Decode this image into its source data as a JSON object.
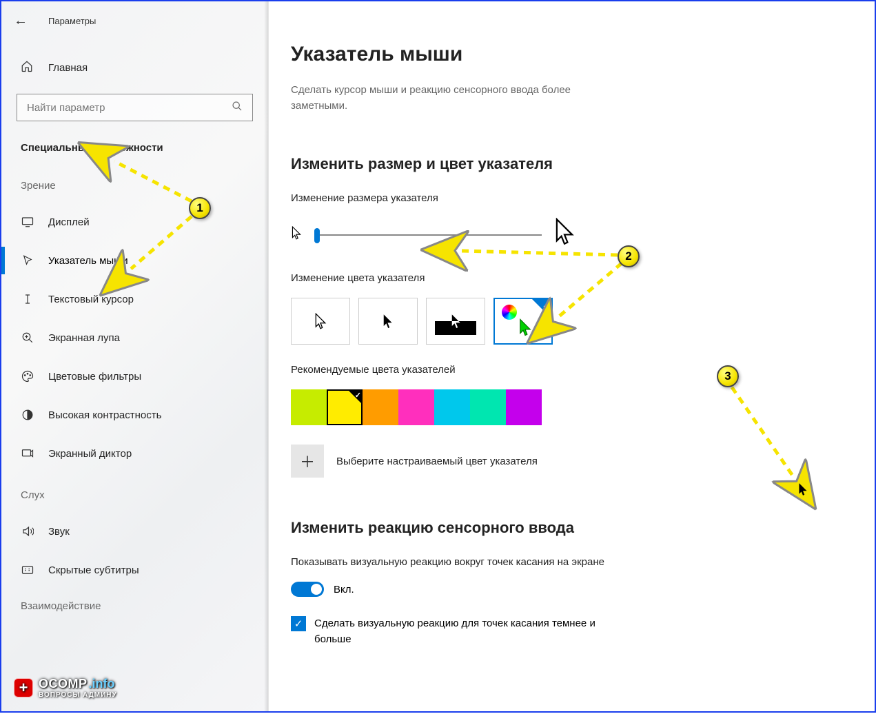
{
  "header": {
    "app_title": "Параметры"
  },
  "sidebar": {
    "home": "Главная",
    "search_placeholder": "Найти параметр",
    "group": "Специальные возможности",
    "cat_vision": "Зрение",
    "cat_hearing": "Слух",
    "cat_interaction": "Взаимодействие",
    "items_vision": [
      "Дисплей",
      "Указатель мыши",
      "Текстовый курсор",
      "Экранная лупа",
      "Цветовые фильтры",
      "Высокая контрастность",
      "Экранный диктор"
    ],
    "items_hearing": [
      "Звук",
      "Скрытые субтитры"
    ]
  },
  "main": {
    "title": "Указатель мыши",
    "desc": "Сделать курсор мыши и реакцию сенсорного ввода более заметными.",
    "section_size_color": "Изменить размер и цвет указателя",
    "label_size": "Изменение размера указателя",
    "label_color": "Изменение цвета указателя",
    "label_recommended": "Рекомендуемые цвета указателей",
    "custom_color": "Выберите настраиваемый цвет указателя",
    "section_touch": "Изменить реакцию сенсорного ввода",
    "label_touch_show": "Показывать визуальную реакцию вокруг точек касания на экране",
    "toggle_state": "Вкл.",
    "check_darker": "Сделать визуальную реакцию для точек касания темнее и больше"
  },
  "colors": {
    "swatches": [
      "#c6ec00",
      "#ffec00",
      "#ff9c00",
      "#ff2fbd",
      "#00c8ec",
      "#00e6b0",
      "#c400ec"
    ],
    "selected_swatch_index": 1,
    "accent": "#0078d4"
  },
  "annotations": {
    "markers": [
      "1",
      "2",
      "3"
    ]
  },
  "watermark": {
    "brand": "OCOMP",
    "tld": ".info",
    "sub": "ВОПРОСЫ АДМИНУ"
  }
}
